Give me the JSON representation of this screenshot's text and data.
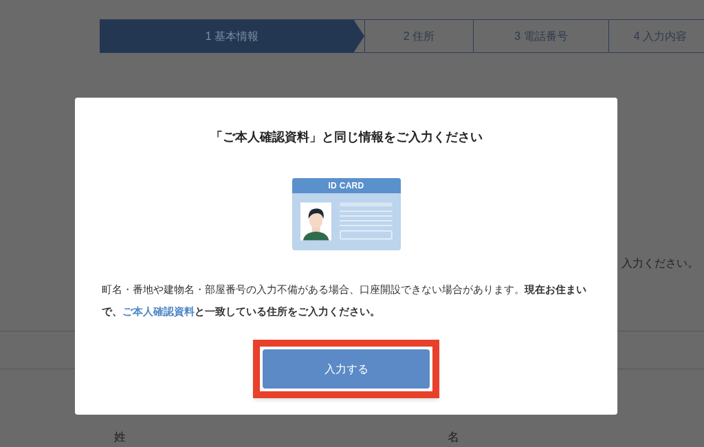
{
  "steps": [
    {
      "label": "1 基本情報",
      "selected": true
    },
    {
      "label": "2 住所",
      "selected": false
    },
    {
      "label": "3 電話番号",
      "selected": false
    },
    {
      "label": "4 入力内容",
      "selected": false
    }
  ],
  "background": {
    "hint": "入力ください。",
    "fields": [
      {
        "label": "姓"
      },
      {
        "label": "名"
      }
    ]
  },
  "dialog": {
    "title": "「ご本人確認資料」と同じ情報をご入力ください",
    "card": {
      "title": "ID CARD"
    },
    "message": {
      "before": "町名・番地や建物名・部屋番号の入力不備がある場合、口座開設できない場合があります。**現在お住まいで、**",
      "link": "ご本人確認資料",
      "after": "**と一致している住所をご入力ください。**"
    },
    "button": {
      "label": "入力する",
      "highlighted": true
    }
  }
}
